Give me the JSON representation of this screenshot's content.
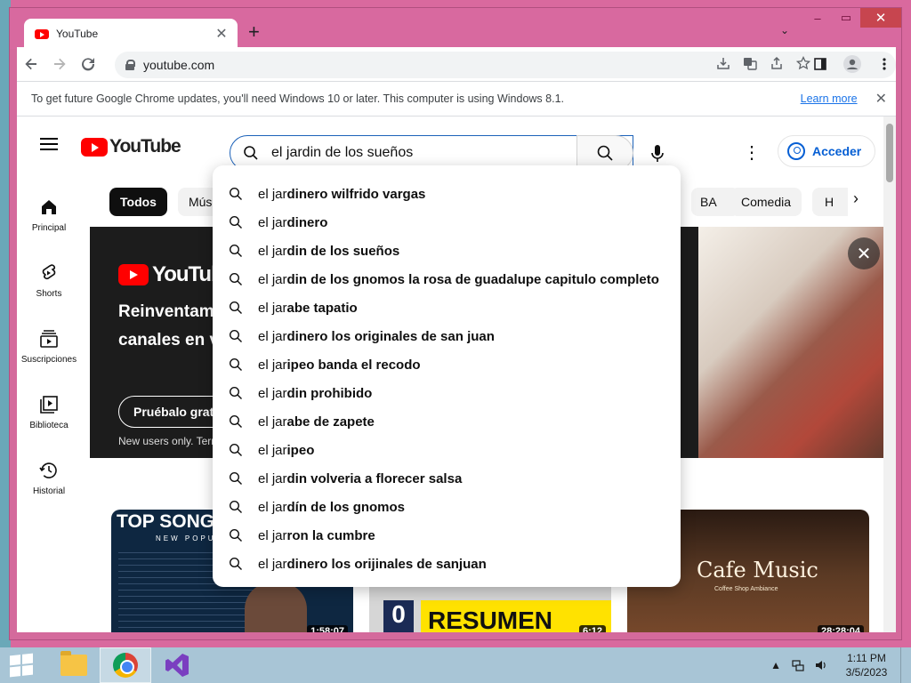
{
  "browser": {
    "tab_title": "YouTube",
    "tab_close": "✕",
    "new_tab": "+",
    "tab_search": "⌄",
    "url": "youtube.com",
    "window_controls": {
      "minimize": "–",
      "maximize": "▭",
      "close": "✕"
    }
  },
  "infobar": {
    "message": "To get future Google Chrome updates, you'll need Windows 10 or later. This computer is using Windows 8.1.",
    "link": "Learn more",
    "close": "✕"
  },
  "youtube": {
    "logo_text": "YouTube",
    "search_value": "el jardin de los sueños",
    "more_menu": "⋮",
    "signin_label": "Acceder",
    "guide": [
      {
        "label": "Principal",
        "icon": "home-icon"
      },
      {
        "label": "Shorts",
        "icon": "shorts-icon"
      },
      {
        "label": "Suscripciones",
        "icon": "subscriptions-icon"
      },
      {
        "label": "Biblioteca",
        "icon": "library-icon"
      },
      {
        "label": "Historial",
        "icon": "history-icon"
      }
    ],
    "chips": [
      "Todos",
      "Música"
    ],
    "chips_right": [
      "BA",
      "Comedia",
      "H"
    ],
    "chip_next": "›",
    "banner": {
      "logo_text": "YouTubeTV",
      "headline_1": "Reinventamos",
      "headline_2": "canales en viv",
      "cta": "Pruébalo gratis",
      "fine_print": "New users only. Terms",
      "dismiss": "✕"
    },
    "videos": [
      {
        "title_overlay": "TOP SONGS 2",
        "subtitle": "NEW POPULAR SON",
        "duration": "1:58:07"
      },
      {
        "score": "0",
        "title_overlay": "RESUMEN",
        "duration": "6:12"
      },
      {
        "title_overlay": "Cafe Music",
        "subtitle": "Coffee Shop Ambiance",
        "duration": "28:28:04"
      }
    ],
    "suggestions": [
      {
        "prefix": "el jar",
        "rest": "dinero wilfrido vargas"
      },
      {
        "prefix": "el jar",
        "rest": "dinero"
      },
      {
        "prefix": "el jar",
        "rest": "din de los sueños"
      },
      {
        "prefix": "el jar",
        "rest": "din de los gnomos la rosa de guadalupe capitulo completo"
      },
      {
        "prefix": "el jar",
        "rest": "abe tapatio"
      },
      {
        "prefix": "el jar",
        "rest": "dinero los originales de san juan"
      },
      {
        "prefix": "el jar",
        "rest": "ipeo banda el recodo"
      },
      {
        "prefix": "el jar",
        "rest": "din prohibido"
      },
      {
        "prefix": "el jar",
        "rest": "abe de zapete"
      },
      {
        "prefix": "el jar",
        "rest": "ipeo"
      },
      {
        "prefix": "el jar",
        "rest": "din volveria a florecer salsa"
      },
      {
        "prefix": "el jar",
        "rest": "dín de los gnomos"
      },
      {
        "prefix": "el jar",
        "rest": "ron la cumbre"
      },
      {
        "prefix": "el jar",
        "rest": "dinero los orijinales de sanjuan"
      }
    ]
  },
  "taskbar": {
    "time": "1:11 PM",
    "date": "3/5/2023",
    "tray_chevron": "▲"
  },
  "colors": {
    "window_frame": "#d8699f",
    "youtube_red": "#ff0000",
    "link_blue": "#065fd4",
    "search_focus": "#1c62b9"
  }
}
